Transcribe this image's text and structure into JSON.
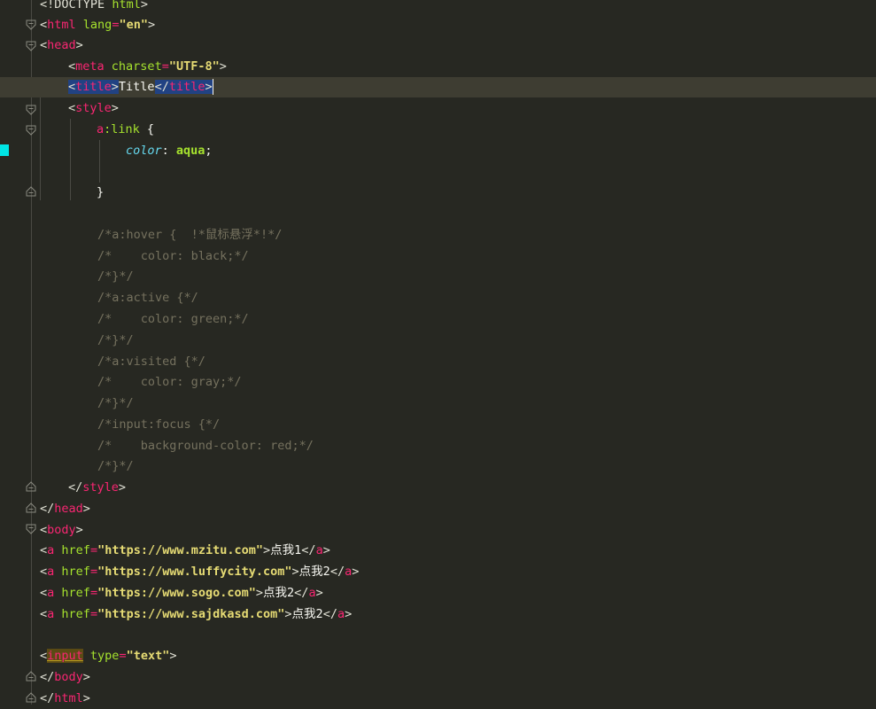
{
  "lines": {
    "l1": {
      "lt": "<",
      "doctype": "!DOCTYPE",
      "html": "html",
      "gt": ">"
    },
    "l2": {
      "lt": "<",
      "tag": "html",
      "attr": "lang",
      "eq": "=",
      "val": "\"en\"",
      "gt": ">"
    },
    "l3": {
      "lt": "<",
      "tag": "head",
      "gt": ">"
    },
    "l4": {
      "lt": "<",
      "tag": "meta",
      "attr": "charset",
      "eq": "=",
      "val": "\"UTF-8\"",
      "gt": ">"
    },
    "l5": {
      "open_lt": "<",
      "open_tag": "title",
      "open_gt": ">",
      "text": "Title",
      "close_lt": "</",
      "close_tag": "title",
      "close_gt": ">"
    },
    "l6": {
      "lt": "<",
      "tag": "style",
      "gt": ">"
    },
    "l7": {
      "sel_tag": "a",
      "pseudo": ":link",
      "brace": " {"
    },
    "l8": {
      "prop": "color",
      "colon": ": ",
      "val": "aqua",
      "semi": ";"
    },
    "l10": {
      "brace": "}"
    },
    "c1": "/*a:hover {  !*鼠标悬浮*!*/",
    "c2": "/*    color: black;*/",
    "c3": "/*}*/",
    "c4": "/*a:active {*/",
    "c5": "/*    color: green;*/",
    "c6": "/*}*/",
    "c7": "/*a:visited {*/",
    "c8": "/*    color: gray;*/",
    "c9": "/*}*/",
    "c10": "/*input:focus {*/",
    "c11": "/*    background-color: red;*/",
    "c12": "/*}*/",
    "l24": {
      "lt": "</",
      "tag": "style",
      "gt": ">"
    },
    "l25": {
      "lt": "</",
      "tag": "head",
      "gt": ">"
    },
    "l26": {
      "lt": "<",
      "tag": "body",
      "gt": ">"
    },
    "links": [
      {
        "lt": "<",
        "tag": "a",
        "attr": "href",
        "eq": "=",
        "href": "\"https://www.mzitu.com\"",
        "gt": ">",
        "text": "点我1",
        "close_lt": "</",
        "close_tag": "a",
        "close_gt": ">"
      },
      {
        "lt": "<",
        "tag": "a",
        "attr": "href",
        "eq": "=",
        "href": "\"https://www.luffycity.com\"",
        "gt": ">",
        "text": "点我2",
        "close_lt": "</",
        "close_tag": "a",
        "close_gt": ">"
      },
      {
        "lt": "<",
        "tag": "a",
        "attr": "href",
        "eq": "=",
        "href": "\"https://www.sogo.com\"",
        "gt": ">",
        "text": "点我2",
        "close_lt": "</",
        "close_tag": "a",
        "close_gt": ">"
      },
      {
        "lt": "<",
        "tag": "a",
        "attr": "href",
        "eq": "=",
        "href": "\"https://www.sajdkasd.com\"",
        "gt": ">",
        "text": "点我2",
        "close_lt": "</",
        "close_tag": "a",
        "close_gt": ">"
      }
    ],
    "l32": {
      "lt": "<",
      "tag": "input",
      "attr": "type",
      "eq": "=",
      "val": "\"text\"",
      "gt": ">"
    },
    "l33": {
      "lt": "</",
      "tag": "body",
      "gt": ">"
    },
    "l34": {
      "lt": "</",
      "tag": "html",
      "gt": ">"
    }
  },
  "colors": {
    "background": "#272822",
    "tag": "#f92672",
    "attribute": "#a6e22e",
    "string": "#e6db74",
    "comment": "#75715e",
    "property": "#66d9ef",
    "selection": "#214283",
    "change_marker": "#00e5e5"
  }
}
